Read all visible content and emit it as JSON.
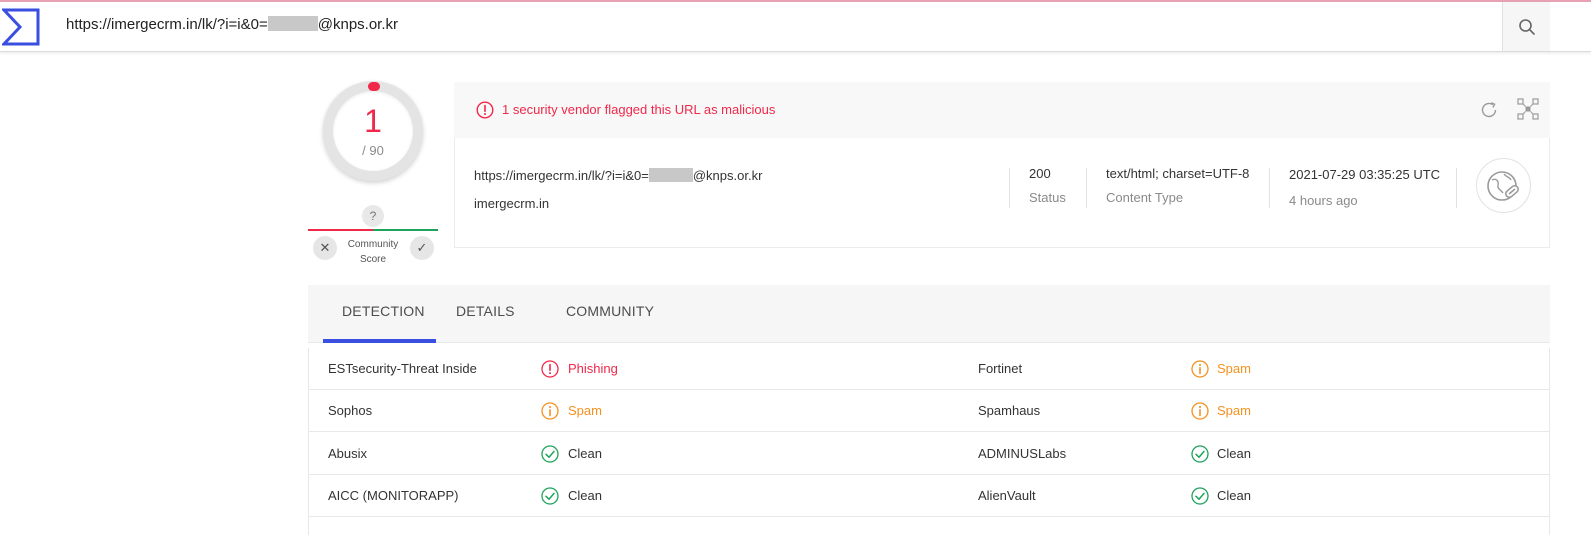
{
  "toolbar": {
    "url_prefix": "https://imergecrm.in/lk/?i=i&0=",
    "url_suffix": "@knps.or.kr",
    "search_icon": "search-icon"
  },
  "score": {
    "detections": "1",
    "total": "/ 90",
    "community_q": "?",
    "community_label_1": "Community",
    "community_label_2": "Score",
    "downvote": "✕",
    "upvote": "✓"
  },
  "header": {
    "alert": "1 security vendor flagged this URL as malicious",
    "url_prefix": "https://imergecrm.in/lk/?i=i&0=",
    "url_suffix": "@knps.or.kr",
    "domain": "imergecrm.in",
    "status_value": "200",
    "status_label": "Status",
    "content_type_value": "text/html; charset=UTF-8",
    "content_type_label": "Content Type",
    "date_value": "2021-07-29 03:35:25 UTC",
    "date_relative": "4 hours ago"
  },
  "tabs": [
    {
      "label": "DETECTION",
      "active": true
    },
    {
      "label": "DETAILS",
      "active": false
    },
    {
      "label": "COMMUNITY",
      "active": false
    }
  ],
  "detections": [
    {
      "left_vendor": "ESTsecurity-Threat Inside",
      "left_result": "Phishing",
      "left_type": "malicious",
      "right_vendor": "Fortinet",
      "right_result": "Spam",
      "right_type": "suspicious"
    },
    {
      "left_vendor": "Sophos",
      "left_result": "Spam",
      "left_type": "suspicious",
      "right_vendor": "Spamhaus",
      "right_result": "Spam",
      "right_type": "suspicious"
    },
    {
      "left_vendor": "Abusix",
      "left_result": "Clean",
      "left_type": "clean",
      "right_vendor": "ADMINUSLabs",
      "right_result": "Clean",
      "right_type": "clean"
    },
    {
      "left_vendor": "AICC (MONITORAPP)",
      "left_result": "Clean",
      "left_type": "clean",
      "right_vendor": "AlienVault",
      "right_result": "Clean",
      "right_type": "clean"
    }
  ],
  "colors": {
    "malicious": "#f0284a",
    "suspicious": "#f5911e",
    "clean": "#1fa25b",
    "accent": "#3a4ee0"
  }
}
